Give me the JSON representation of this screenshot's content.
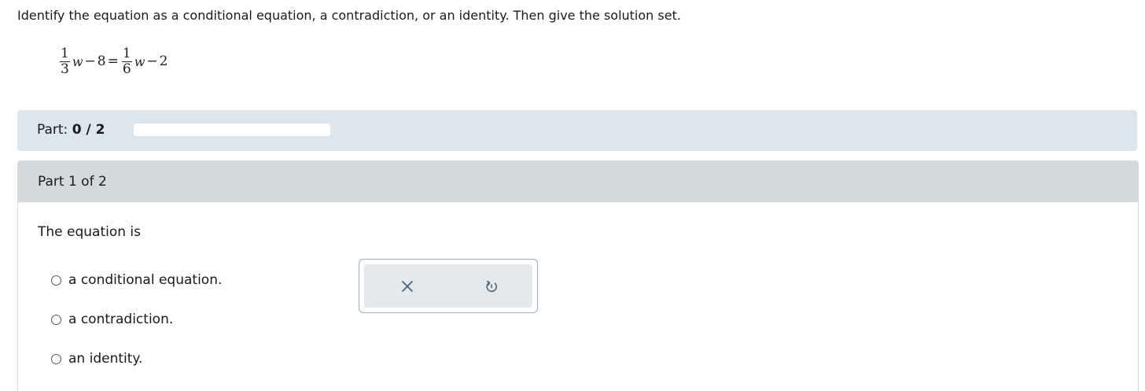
{
  "prompt": "Identify the equation as a conditional equation, a contradiction, or an identity. Then give the solution set.",
  "equation": {
    "left_frac_num": "1",
    "left_frac_den": "3",
    "left_var": "w",
    "left_op": "−",
    "left_const": "8",
    "equals": "=",
    "right_frac_num": "1",
    "right_frac_den": "6",
    "right_var": "w",
    "right_op": "−",
    "right_const": "2"
  },
  "progress": {
    "label": "Part:",
    "value_text": "0 / 2",
    "fraction": 0
  },
  "part": {
    "header": "Part 1 of 2",
    "question": "The equation is",
    "options": [
      "a conditional equation.",
      "a contradiction.",
      "an identity."
    ]
  },
  "tools": {
    "clear_icon": "close-icon",
    "undo_icon": "undo-icon"
  },
  "colors": {
    "banner": "#dbe6ef",
    "part_header": "#d3dadd",
    "tool_inner": "#e4e9ed",
    "icon": "#4a6578"
  }
}
